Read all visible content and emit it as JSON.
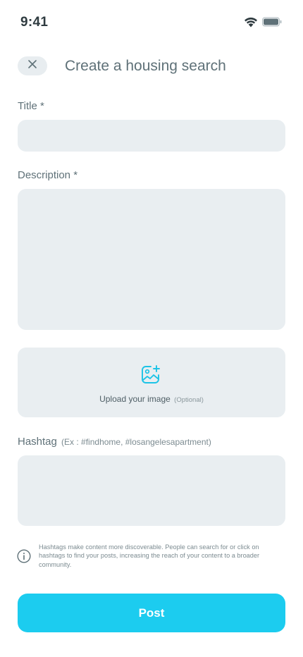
{
  "status_bar": {
    "time": "9:41",
    "icons": [
      "wifi-icon",
      "battery-icon"
    ]
  },
  "header": {
    "close_icon": "close-icon",
    "title": "Create a housing search"
  },
  "form": {
    "title_label": "Title *",
    "title_value": "",
    "description_label": "Description *",
    "description_value": "",
    "upload": {
      "icon": "add-image-icon",
      "label": "Upload your image",
      "optional": "(Optional)"
    },
    "hashtag_label": "Hashtag",
    "hashtag_hint": "(Ex : #findhome, #losangelesapartment)",
    "hashtag_value": "",
    "info_icon": "info-icon",
    "info_text": "Hashtags make content more discoverable. People can search for or click on hashtags to find your posts, increasing the reach of your content to a broader community."
  },
  "post_button": {
    "label": "Post"
  },
  "colors": {
    "accent": "#1cccef",
    "field_bg": "#e9eef1",
    "text_muted": "#5f7178"
  }
}
